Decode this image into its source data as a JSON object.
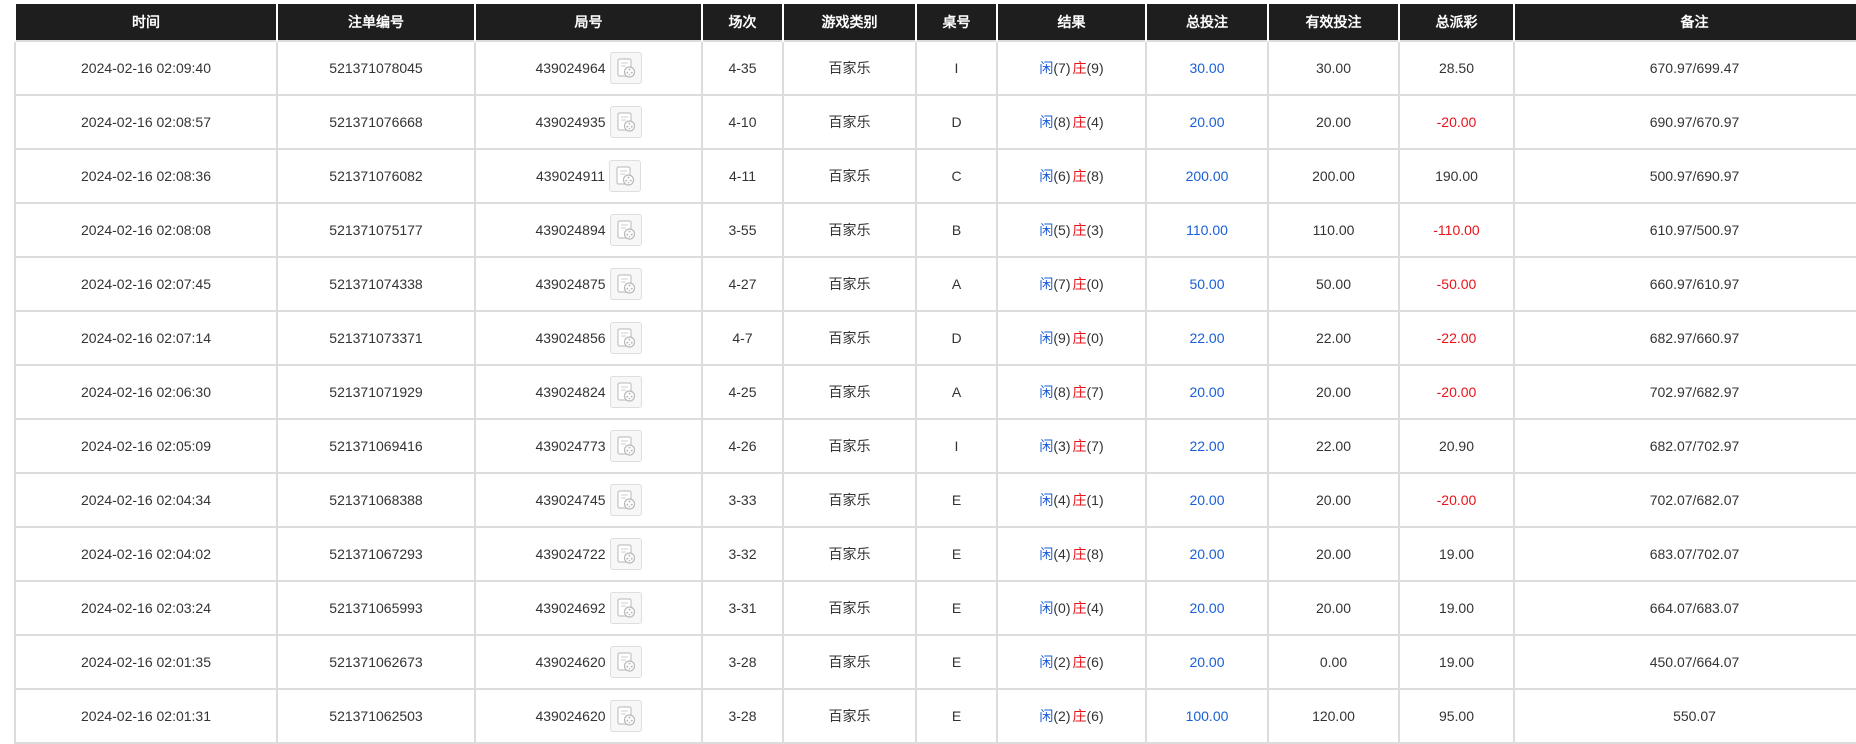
{
  "columns": [
    "时间",
    "注单编号",
    "局号",
    "场次",
    "游戏类别",
    "桌号",
    "结果",
    "总投注",
    "有效投注",
    "总派彩",
    "备注"
  ],
  "result_labels": {
    "player": "闲",
    "banker": "庄"
  },
  "colors": {
    "header_bg": "#1e1e1e",
    "blue": "#1a5fd6",
    "red": "#e8131b",
    "border": "#dcdcdc"
  },
  "rows": [
    {
      "time": "2024-02-16 02:09:40",
      "bet_id": "521371078045",
      "round_id": "439024964",
      "session": "4-35",
      "game": "百家乐",
      "table": "I",
      "player": "(7)",
      "banker": "(9)",
      "total_bet": "30.00",
      "valid_bet": "30.00",
      "payout": "28.50",
      "payout_negative": false,
      "note": "670.97/699.47"
    },
    {
      "time": "2024-02-16 02:08:57",
      "bet_id": "521371076668",
      "round_id": "439024935",
      "session": "4-10",
      "game": "百家乐",
      "table": "D",
      "player": "(8)",
      "banker": "(4)",
      "total_bet": "20.00",
      "valid_bet": "20.00",
      "payout": "-20.00",
      "payout_negative": true,
      "note": "690.97/670.97"
    },
    {
      "time": "2024-02-16 02:08:36",
      "bet_id": "521371076082",
      "round_id": "439024911",
      "session": "4-11",
      "game": "百家乐",
      "table": "C",
      "player": "(6)",
      "banker": "(8)",
      "total_bet": "200.00",
      "valid_bet": "200.00",
      "payout": "190.00",
      "payout_negative": false,
      "note": "500.97/690.97"
    },
    {
      "time": "2024-02-16 02:08:08",
      "bet_id": "521371075177",
      "round_id": "439024894",
      "session": "3-55",
      "game": "百家乐",
      "table": "B",
      "player": "(5)",
      "banker": "(3)",
      "total_bet": "110.00",
      "valid_bet": "110.00",
      "payout": "-110.00",
      "payout_negative": true,
      "note": "610.97/500.97"
    },
    {
      "time": "2024-02-16 02:07:45",
      "bet_id": "521371074338",
      "round_id": "439024875",
      "session": "4-27",
      "game": "百家乐",
      "table": "A",
      "player": "(7)",
      "banker": "(0)",
      "total_bet": "50.00",
      "valid_bet": "50.00",
      "payout": "-50.00",
      "payout_negative": true,
      "note": "660.97/610.97"
    },
    {
      "time": "2024-02-16 02:07:14",
      "bet_id": "521371073371",
      "round_id": "439024856",
      "session": "4-7",
      "game": "百家乐",
      "table": "D",
      "player": "(9)",
      "banker": "(0)",
      "total_bet": "22.00",
      "valid_bet": "22.00",
      "payout": "-22.00",
      "payout_negative": true,
      "note": "682.97/660.97"
    },
    {
      "time": "2024-02-16 02:06:30",
      "bet_id": "521371071929",
      "round_id": "439024824",
      "session": "4-25",
      "game": "百家乐",
      "table": "A",
      "player": "(8)",
      "banker": "(7)",
      "total_bet": "20.00",
      "valid_bet": "20.00",
      "payout": "-20.00",
      "payout_negative": true,
      "note": "702.97/682.97"
    },
    {
      "time": "2024-02-16 02:05:09",
      "bet_id": "521371069416",
      "round_id": "439024773",
      "session": "4-26",
      "game": "百家乐",
      "table": "I",
      "player": "(3)",
      "banker": "(7)",
      "total_bet": "22.00",
      "valid_bet": "22.00",
      "payout": "20.90",
      "payout_negative": false,
      "note": "682.07/702.97"
    },
    {
      "time": "2024-02-16 02:04:34",
      "bet_id": "521371068388",
      "round_id": "439024745",
      "session": "3-33",
      "game": "百家乐",
      "table": "E",
      "player": "(4)",
      "banker": "(1)",
      "total_bet": "20.00",
      "valid_bet": "20.00",
      "payout": "-20.00",
      "payout_negative": true,
      "note": "702.07/682.07"
    },
    {
      "time": "2024-02-16 02:04:02",
      "bet_id": "521371067293",
      "round_id": "439024722",
      "session": "3-32",
      "game": "百家乐",
      "table": "E",
      "player": "(4)",
      "banker": "(8)",
      "total_bet": "20.00",
      "valid_bet": "20.00",
      "payout": "19.00",
      "payout_negative": false,
      "note": "683.07/702.07"
    },
    {
      "time": "2024-02-16 02:03:24",
      "bet_id": "521371065993",
      "round_id": "439024692",
      "session": "3-31",
      "game": "百家乐",
      "table": "E",
      "player": "(0)",
      "banker": "(4)",
      "total_bet": "20.00",
      "valid_bet": "20.00",
      "payout": "19.00",
      "payout_negative": false,
      "note": "664.07/683.07"
    },
    {
      "time": "2024-02-16 02:01:35",
      "bet_id": "521371062673",
      "round_id": "439024620",
      "session": "3-28",
      "game": "百家乐",
      "table": "E",
      "player": "(2)",
      "banker": "(6)",
      "total_bet": "20.00",
      "valid_bet": "0.00",
      "payout": "19.00",
      "payout_negative": false,
      "note": "450.07/664.07"
    },
    {
      "time": "2024-02-16 02:01:31",
      "bet_id": "521371062503",
      "round_id": "439024620",
      "session": "3-28",
      "game": "百家乐",
      "table": "E",
      "player": "(2)",
      "banker": "(6)",
      "total_bet": "100.00",
      "valid_bet": "120.00",
      "payout": "95.00",
      "payout_negative": false,
      "note": "550.07"
    }
  ]
}
